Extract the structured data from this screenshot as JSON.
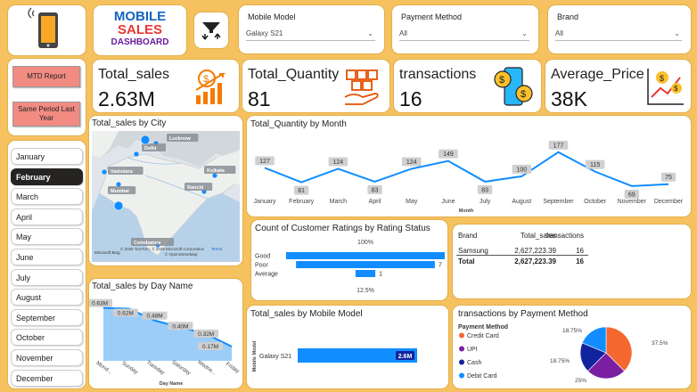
{
  "header": {
    "logo_line1": "MOBILE",
    "logo_line2": "SALES",
    "logo_line3": "DASHBOARD"
  },
  "slicers": {
    "mobile_model": {
      "label": "Mobile Model",
      "value": "Galaxy S21"
    },
    "payment_method": {
      "label": "Payment Method",
      "value": "All"
    },
    "brand": {
      "label": "Brand",
      "value": "All"
    }
  },
  "buttons": {
    "mtd": "MTD Report",
    "same_period_1": "Same Period Last",
    "same_period_2": "Year"
  },
  "kpis": [
    {
      "label": "Total_sales",
      "value": "2.63M"
    },
    {
      "label": "Total_Quantity",
      "value": "81"
    },
    {
      "label": "transactions",
      "value": "16"
    },
    {
      "label": "Average_Price",
      "value": "38K"
    }
  ],
  "months": {
    "selected": "February",
    "items": [
      "January",
      "February",
      "March",
      "April",
      "May",
      "June",
      "July",
      "August",
      "September",
      "October",
      "November",
      "December"
    ]
  },
  "map": {
    "title": "Total_sales by City",
    "cities": [
      "Lucknow",
      "Delhi",
      "Vadodara",
      "Kolkata",
      "Mumbai",
      "Ranchi",
      "Coimbatore"
    ],
    "attribution": "© 2025 TomTom, © 2025 Microsoft Corporation",
    "attribution2": "© OpenStreetMap",
    "terms": "Terms",
    "bing": "Microsoft Bing"
  },
  "colors": {
    "accent": "#118dff",
    "background": "#f6c15f",
    "selected_month": "#252423",
    "button": "#f28b82"
  },
  "charts": {
    "quantity_by_month": {
      "title": "Total_Quantity by Month",
      "xlabel": "Month",
      "chart_data": {
        "type": "line",
        "categories": [
          "January",
          "February",
          "March",
          "April",
          "May",
          "June",
          "July",
          "August",
          "September",
          "October",
          "November",
          "December"
        ],
        "values": [
          127,
          81,
          124,
          83,
          124,
          149,
          83,
          100,
          177,
          115,
          69,
          75
        ],
        "ylim": [
          60,
          185
        ]
      }
    },
    "ratings": {
      "title": "Count of Customer Ratings by Rating Status",
      "top_label": "100%",
      "bottom_label": "12.5%",
      "chart_data": {
        "type": "bar",
        "categories": [
          "Good",
          "Poor",
          "Average"
        ],
        "values": [
          8,
          7,
          1
        ],
        "labels": [
          "",
          "7",
          "1"
        ],
        "xlim": [
          0,
          8
        ]
      }
    },
    "sales_by_day": {
      "title": "Total_sales by Day Name",
      "xlabel": "Day Name",
      "chart_data": {
        "type": "area",
        "categories": [
          "Mond...",
          "Sunday",
          "Tuesday",
          "Saturday",
          "Wedne...",
          "Friday"
        ],
        "values": [
          0.63,
          0.62,
          0.48,
          0.4,
          0.32,
          0.17
        ],
        "labels": [
          "0.63M",
          "0.62M",
          "0.48M",
          "0.40M",
          "0.32M",
          "0.17M"
        ],
        "ylim": [
          0,
          0.7
        ]
      }
    },
    "sales_by_model": {
      "title": "Total_sales by Mobile Model",
      "ylabel": "Mobile Model",
      "chart_data": {
        "type": "bar",
        "categories": [
          "Galaxy S21"
        ],
        "values": [
          2.6
        ],
        "labels": [
          "2.6M"
        ],
        "xlim": [
          0,
          2.6
        ]
      }
    },
    "payment": {
      "title": "transactions by Payment Method",
      "legend_title": "Payment Method",
      "chart_data": {
        "type": "pie",
        "categories": [
          "Credit Card",
          "UPI",
          "Cash",
          "Debit Card"
        ],
        "values": [
          37.5,
          25,
          18.75,
          18.75
        ],
        "labels": [
          "37.5%",
          "25%",
          "18.75%",
          "18.75%"
        ],
        "colors": [
          "#f4672f",
          "#7b1fa2",
          "#12239e",
          "#118dff"
        ]
      }
    }
  },
  "table": {
    "headers": [
      "Brand",
      "Total_sales",
      "transactions"
    ],
    "rows": [
      [
        "Samsung",
        "2,627,223.39",
        "16"
      ]
    ],
    "total": [
      "Total",
      "2,627,223.39",
      "16"
    ]
  }
}
